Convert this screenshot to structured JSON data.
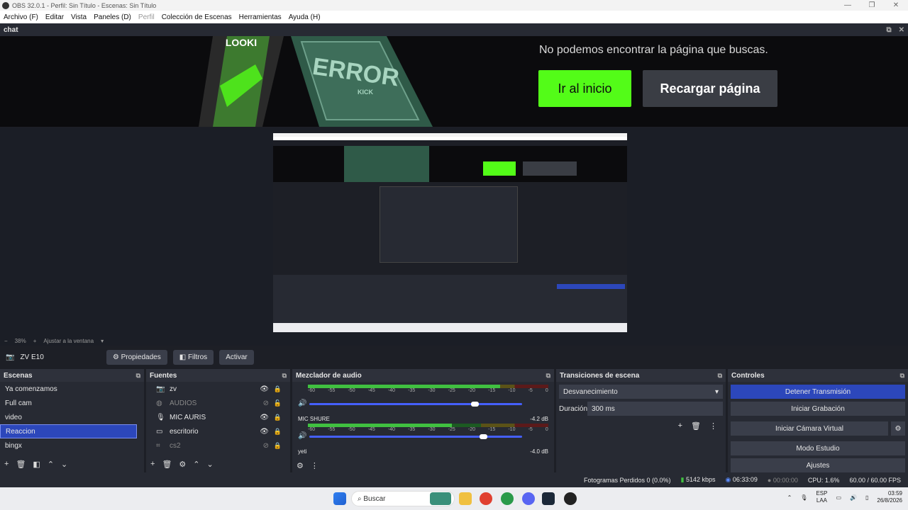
{
  "window": {
    "title": "OBS 32.0.1 - Perfil: Sin Título - Escenas: Sin Título",
    "controls": [
      "—",
      "❐",
      "✕"
    ]
  },
  "menu": {
    "items": [
      "Archivo (F)",
      "Editar",
      "Vista",
      "Paneles (D)",
      "Perfil",
      "Colección de Escenas",
      "Herramientas",
      "Ayuda (H)"
    ]
  },
  "dock": {
    "title": "chat"
  },
  "browser": {
    "error_message": "No podemos encontrar la página que buscas.",
    "home_button": "Ir al inicio",
    "reload_button": "Recargar página",
    "image_text_1": "ERROR",
    "image_text_2": "KICK",
    "image_text_3": "LOOKI"
  },
  "zoom": {
    "minus": "−",
    "level": "38%",
    "plus": "+",
    "fit": "Ajustar a la ventana"
  },
  "source_bar": {
    "scene_name": "ZV E10",
    "properties": "Propiedades",
    "filters": "Filtros",
    "activate": "Activar"
  },
  "scenes": {
    "title": "Escenas",
    "items": [
      "Ya comenzamos",
      "Full cam",
      "video",
      "Reaccion",
      "bingx"
    ],
    "selected": "Reaccion"
  },
  "sources": {
    "title": "Fuentes",
    "items": [
      {
        "label": "zv",
        "icon": "camera-icon",
        "visible": true
      },
      {
        "label": "AUDIOS",
        "icon": "audio-icon",
        "visible": false
      },
      {
        "label": "MIC AURIS",
        "icon": "mic-icon",
        "visible": true
      },
      {
        "label": "escritorio",
        "icon": "monitor-icon",
        "visible": true
      },
      {
        "label": "cs2",
        "icon": "gamepad-icon",
        "visible": false
      }
    ]
  },
  "mixer": {
    "title": "Mezclador de audio",
    "channels": [
      {
        "name": "",
        "db": "",
        "level": 0.8,
        "volume": 0.76
      },
      {
        "name": "MIC SHURE",
        "db": "-4.2 dB",
        "level": 0.6,
        "volume": 0.8
      },
      {
        "name": "yeti",
        "db": "-4.0 dB",
        "level": 0,
        "volume": 0
      }
    ],
    "scale": [
      "-60",
      "-55",
      "-50",
      "-45",
      "-40",
      "-35",
      "-30",
      "-25",
      "-20",
      "-15",
      "-10",
      "-5",
      "0"
    ]
  },
  "transitions": {
    "title": "Transiciones de escena",
    "selected": "Desvanecimiento",
    "duration_label": "Duración",
    "duration_value": "300 ms"
  },
  "controls": {
    "title": "Controles",
    "stop_stream": "Detener Transmisión",
    "start_recording": "Iniciar Grabación",
    "virtual_camera": "Iniciar Cámara Virtual",
    "studio_mode": "Modo Estudio",
    "settings": "Ajustes"
  },
  "status": {
    "dropped_frames": "Fotogramas Perdidos 0 (0.0%)",
    "bitrate": "5142 kbps",
    "stream_time": "06:33:09",
    "record_time": "00:00:00",
    "cpu": "CPU: 1.6%",
    "fps": "60.00 / 60.00 FPS"
  },
  "taskbar": {
    "search": "Buscar",
    "lang_1": "ESP",
    "lang_2": "LAA",
    "time": "03:59",
    "date": "26/8/2026"
  },
  "colors": {
    "accent": "#2c47bb",
    "kick_green": "#53fc18",
    "bg": "#1d1f26",
    "panel": "#272a33"
  }
}
